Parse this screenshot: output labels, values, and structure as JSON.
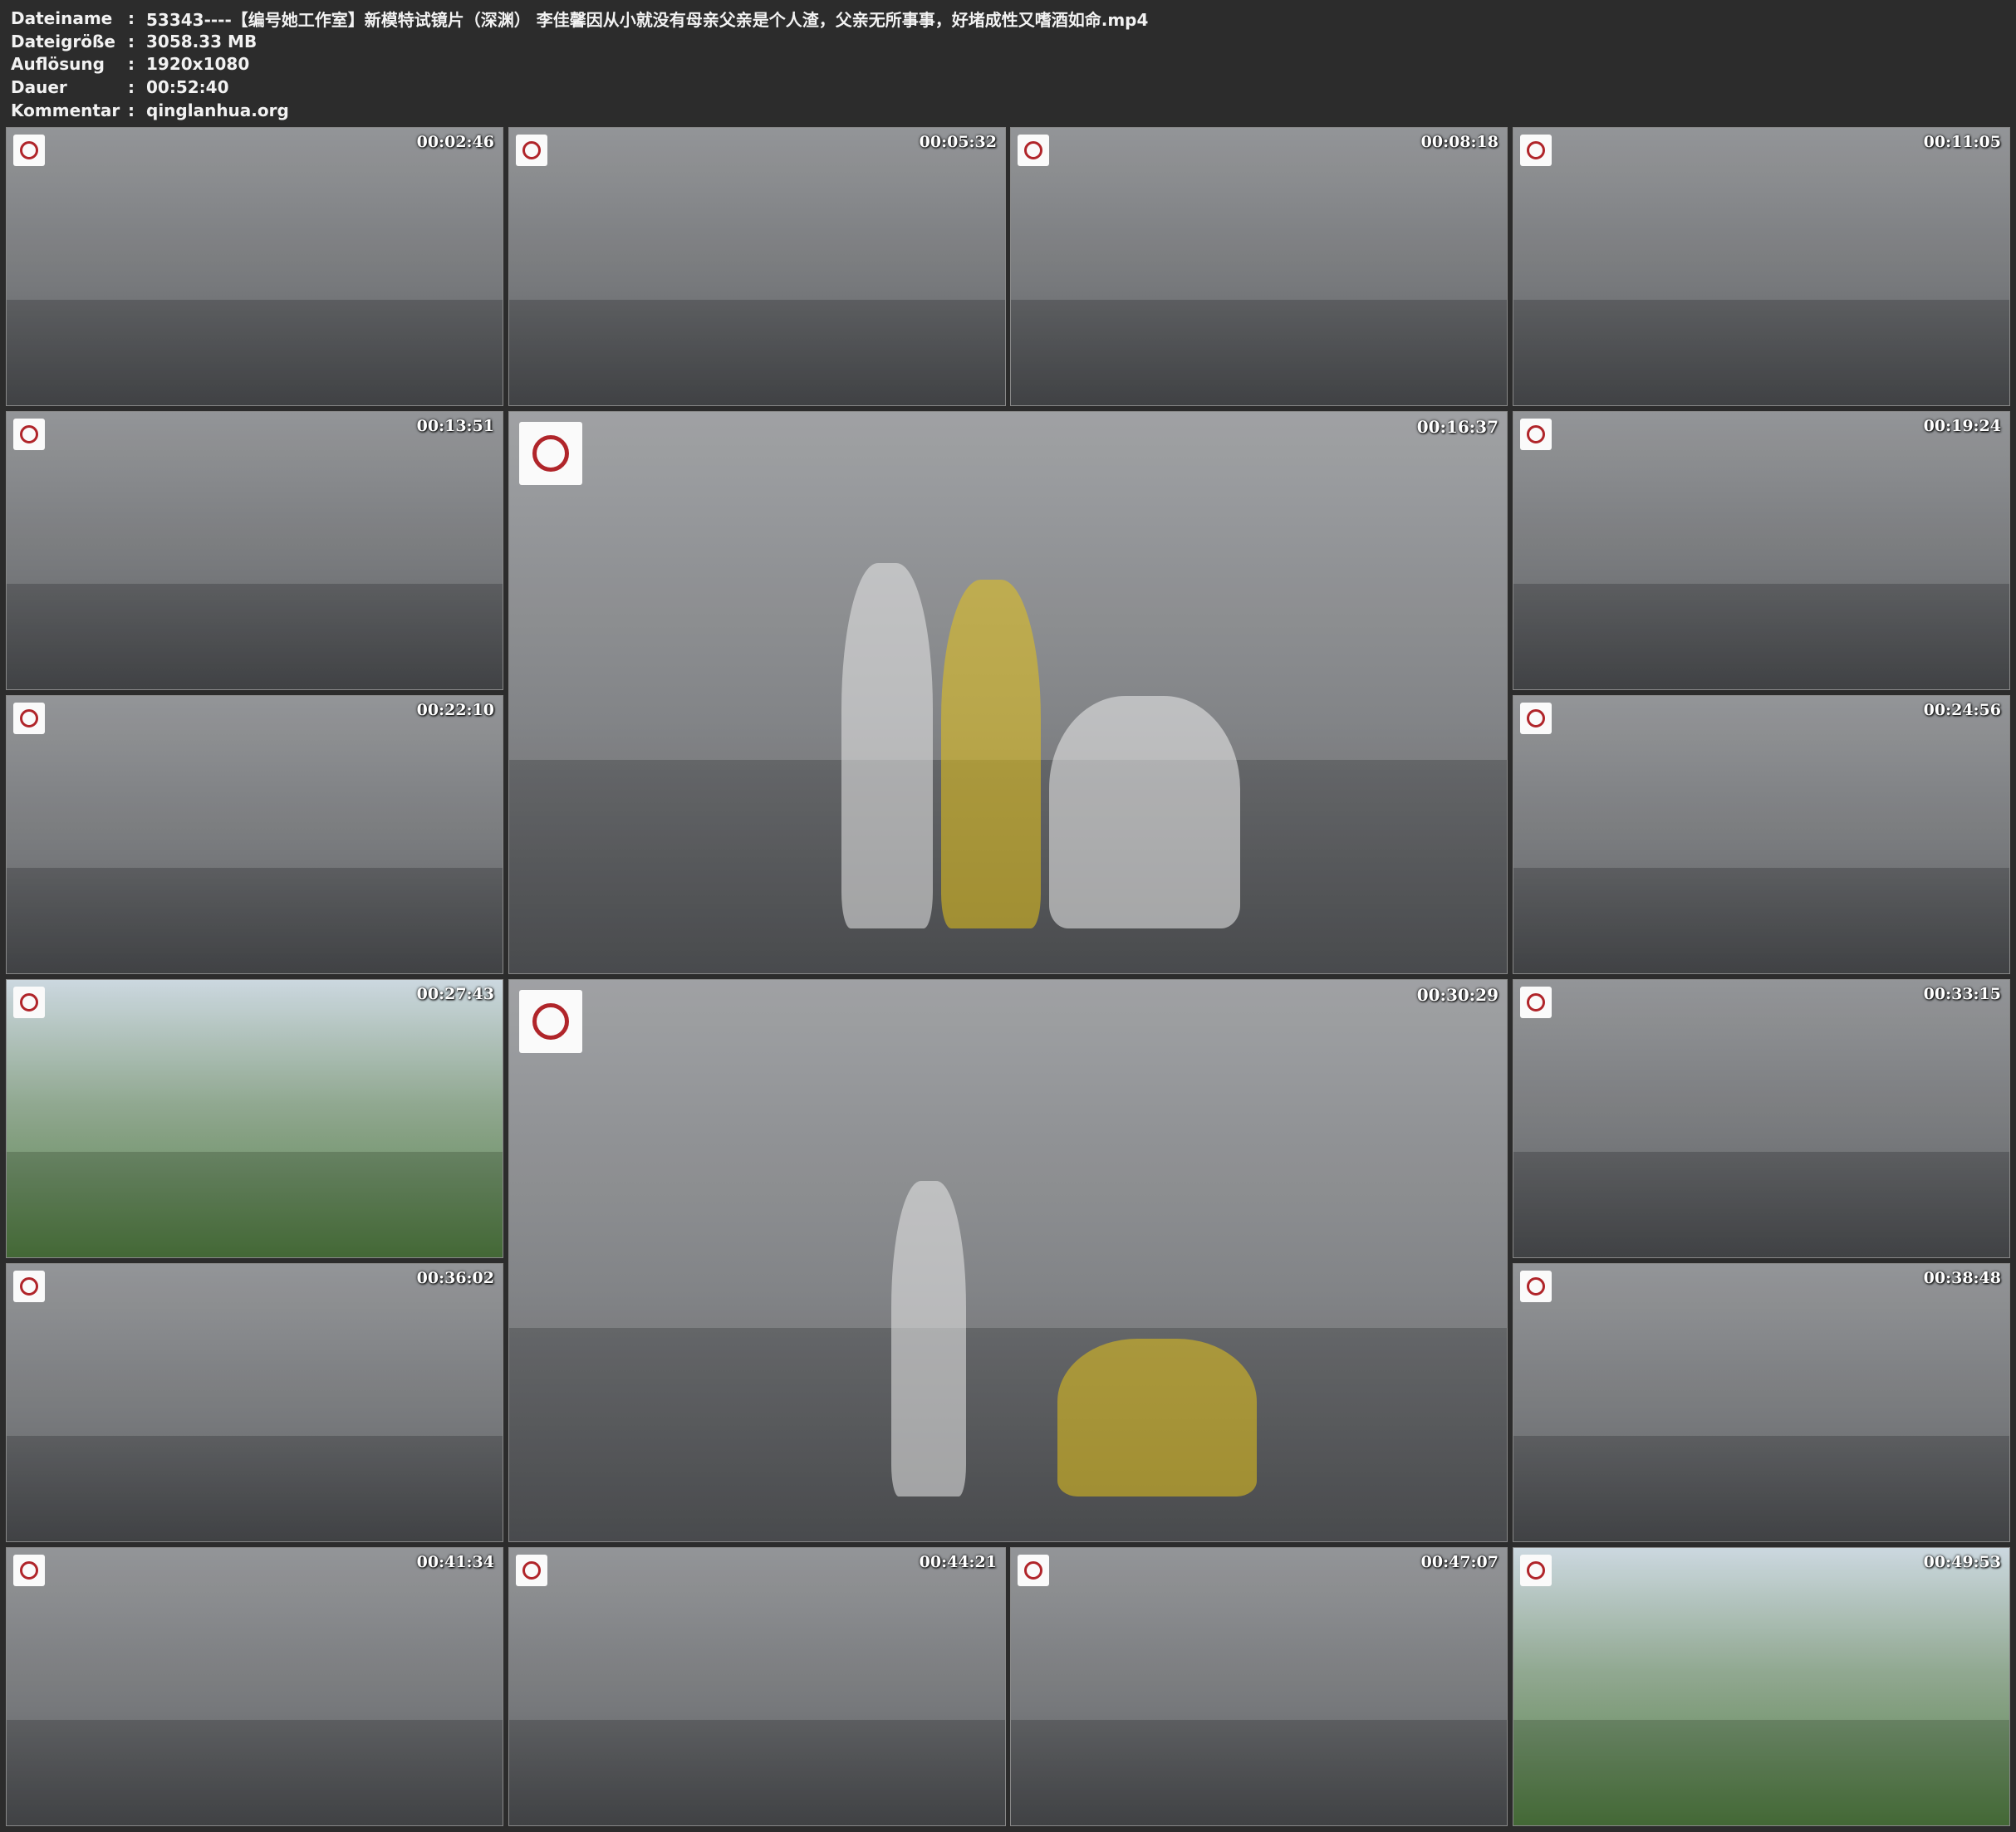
{
  "header": {
    "rows": [
      {
        "key": "Dateiname",
        "sep": ":",
        "value": "53343----【编号她工作室】新模特试镜片（深渊） 李佳馨因从小就没有母亲父亲是个人渣，父亲无所事事，好堵成性又嗜酒如命.mp4"
      },
      {
        "key": "Dateigröße",
        "sep": ":",
        "value": "3058.33 MB"
      },
      {
        "key": "Auflösung",
        "sep": ":",
        "value": "1920x1080"
      },
      {
        "key": "Dauer",
        "sep": ":",
        "value": "00:52:40"
      },
      {
        "key": "Kommentar",
        "sep": ":",
        "value": "qinglanhua.org"
      }
    ]
  },
  "thumbnails": [
    {
      "timestamp": "00:02:46"
    },
    {
      "timestamp": "00:05:32"
    },
    {
      "timestamp": "00:08:18"
    },
    {
      "timestamp": "00:11:05"
    },
    {
      "timestamp": "00:13:51"
    },
    {
      "timestamp": "00:16:37"
    },
    {
      "timestamp": "00:19:24"
    },
    {
      "timestamp": "00:22:10"
    },
    {
      "timestamp": "00:24:56"
    },
    {
      "timestamp": "00:27:43"
    },
    {
      "timestamp": "00:30:29"
    },
    {
      "timestamp": "00:33:15"
    },
    {
      "timestamp": "00:36:02"
    },
    {
      "timestamp": "00:38:48"
    },
    {
      "timestamp": "00:41:34"
    },
    {
      "timestamp": "00:44:21"
    },
    {
      "timestamp": "00:47:07"
    },
    {
      "timestamp": "00:49:53"
    }
  ]
}
